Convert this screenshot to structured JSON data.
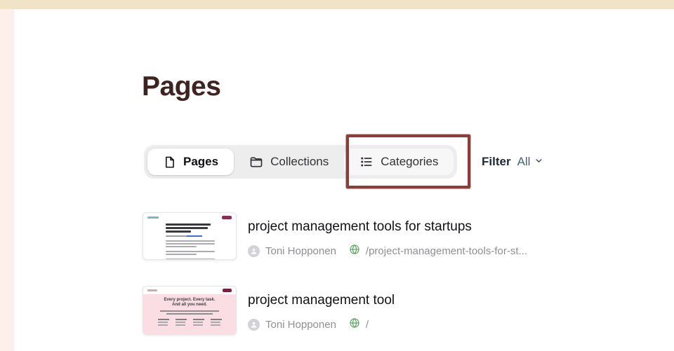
{
  "page": {
    "title": "Pages"
  },
  "tabs": {
    "pages": {
      "label": "Pages"
    },
    "collections": {
      "label": "Collections"
    },
    "categories": {
      "label": "Categories"
    }
  },
  "filter": {
    "label": "Filter",
    "value": "All"
  },
  "items": [
    {
      "title": "project management tools for startups",
      "author": "Toni Hopponen",
      "path": "/project-management-tools-for-st..."
    },
    {
      "title": "project management tool",
      "author": "Toni Hopponen",
      "path": "/",
      "thumbnail_heading": "Every project. Every task. And all you need."
    }
  ],
  "colors": {
    "title_maroon": "#3f2320",
    "annotation_red": "#8d3c38",
    "filter_value_blue": "#46607b",
    "globe_green": "#58a55c",
    "top_strip_beige": "#f1e3c6",
    "left_strip_pink": "#fdf0ea",
    "thumb2_pink": "#fbdee3"
  },
  "icons": {
    "pages_tab": "document-icon",
    "collections_tab": "folder-icon",
    "categories_tab": "list-icon",
    "filter_dropdown": "chevron-down-icon",
    "author": "person-icon",
    "url": "globe-icon"
  }
}
